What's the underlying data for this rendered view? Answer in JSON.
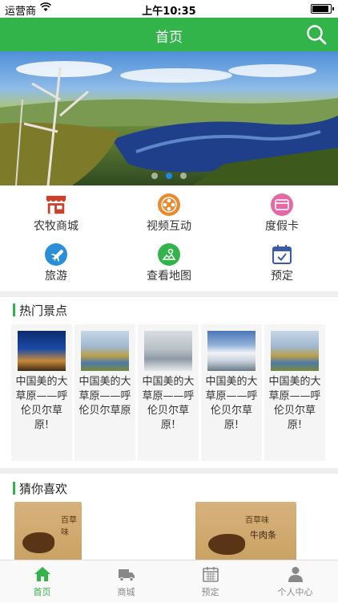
{
  "status_bar": {
    "carrier": "运营商",
    "time": "上午10:35"
  },
  "nav": {
    "title": "首页"
  },
  "menu": [
    {
      "label": "农牧商城",
      "icon": "shop-icon",
      "color": "#c8412b"
    },
    {
      "label": "视频互动",
      "icon": "film-reel-icon",
      "color": "#e98a2e"
    },
    {
      "label": "度假卡",
      "icon": "card-icon",
      "color": "#e36aa5"
    },
    {
      "label": "旅游",
      "icon": "airplane-icon",
      "color": "#2a8fd6"
    },
    {
      "label": "查看地图",
      "icon": "map-pin-icon",
      "color": "#33b44a"
    },
    {
      "label": "预定",
      "icon": "calendar-check-icon",
      "color": "#3b5ba7"
    }
  ],
  "hot_spots": {
    "title": "热门景点",
    "items": [
      {
        "caption": "中国美的大草原——呼伦贝尔草原!"
      },
      {
        "caption": "中国美的大草原——呼伦贝尔草原"
      },
      {
        "caption": "中国美的大草原——呼伦贝尔草原!"
      },
      {
        "caption": "中国美的大草原——呼伦贝尔草原!"
      },
      {
        "caption": "中国美的大草原——呼伦贝尔草原!"
      }
    ]
  },
  "guess": {
    "title": "猜你喜欢",
    "products": [
      {
        "logo": "百草味",
        "name": ""
      },
      {
        "logo": "百草味",
        "name": "牛肉条"
      }
    ]
  },
  "tabs": [
    {
      "label": "首页",
      "icon": "home-icon",
      "active": true
    },
    {
      "label": "商城",
      "icon": "truck-icon",
      "active": false
    },
    {
      "label": "预定",
      "icon": "calendar-icon",
      "active": false
    },
    {
      "label": "个人中心",
      "icon": "person-icon",
      "active": false
    }
  ],
  "colors": {
    "brand": "#33b44a",
    "active_dot": "#1e88e5"
  }
}
